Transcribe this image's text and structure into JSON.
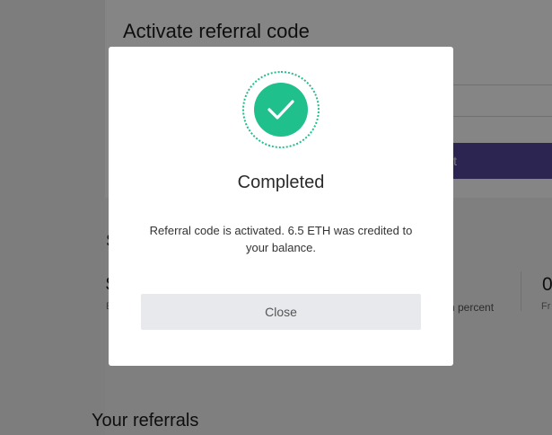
{
  "background": {
    "card_title": "Activate referral code",
    "submit_label_partial": "it",
    "section_heading_partial": "S",
    "stat_value_partial": "$",
    "stat_label_partial": "E",
    "percent_label_partial": "n percent",
    "right_stat_value_partial": "0",
    "right_stat_label_partial": "Fr",
    "referrals_heading": "Your referrals"
  },
  "modal": {
    "status_icon": "checkmark-icon",
    "title": "Completed",
    "message": "Referral code is activated. 6.5 ETH was credited to your balance.",
    "close_label": "Close"
  },
  "colors": {
    "success": "#20c08c",
    "accent": "#55459b",
    "overlay": "rgba(0,0,0,0.48)"
  }
}
